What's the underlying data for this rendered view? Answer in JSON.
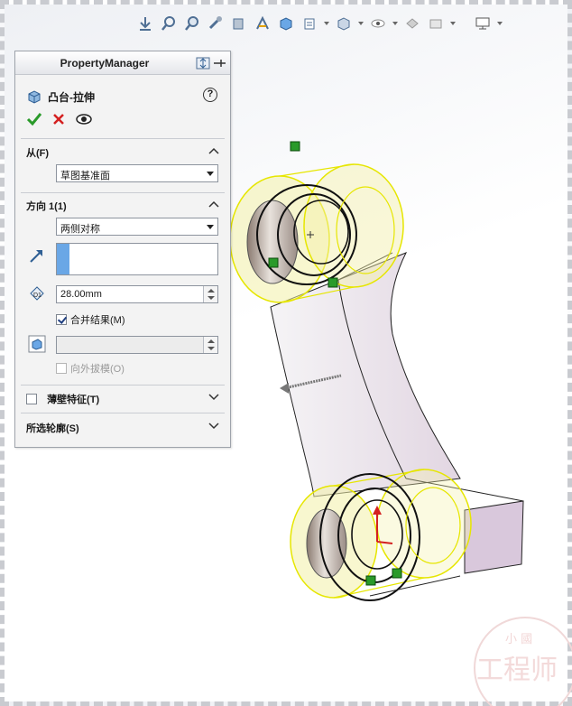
{
  "window": {
    "panel_title": "PropertyManager",
    "feature_name": "凸台-拉伸",
    "help_glyph": "?"
  },
  "icons": {
    "toolbar": [
      "zoom-fit-icon",
      "zoom-area-icon",
      "zoom-in-out-icon",
      "rotate-icon",
      "section-view-icon",
      "view-orientation-icon",
      "display-style-icon",
      "hide-show-icon",
      "edit-appearance-icon",
      "scene-icon",
      "view-settings-icon",
      "display-icon"
    ],
    "accept": "check-icon",
    "cancel": "close-icon",
    "preview": "eye-icon"
  },
  "from_section": {
    "label": "从(F)",
    "value": "草图基准面"
  },
  "direction1_section": {
    "label": "方向 1(1)",
    "end_condition": "两侧对称",
    "depth": "28.00mm",
    "merge_label": "合并结果(M)",
    "merge_checked": true,
    "draft_label": "向外拔模(O)",
    "draft_checked": false
  },
  "thin_feature": {
    "label": "薄壁特征(T)",
    "checked": false
  },
  "selected_contours": {
    "label": "所选轮廓(S)"
  },
  "colors": {
    "accent_blue": "#6aa7e6",
    "check_green": "#2a9a2a",
    "cancel_red": "#d42020",
    "preview_yellow": "#f3f0a8",
    "model_face": "#d9c8dc"
  },
  "watermark": {
    "line1": "小 國",
    "line2": "工程师"
  }
}
